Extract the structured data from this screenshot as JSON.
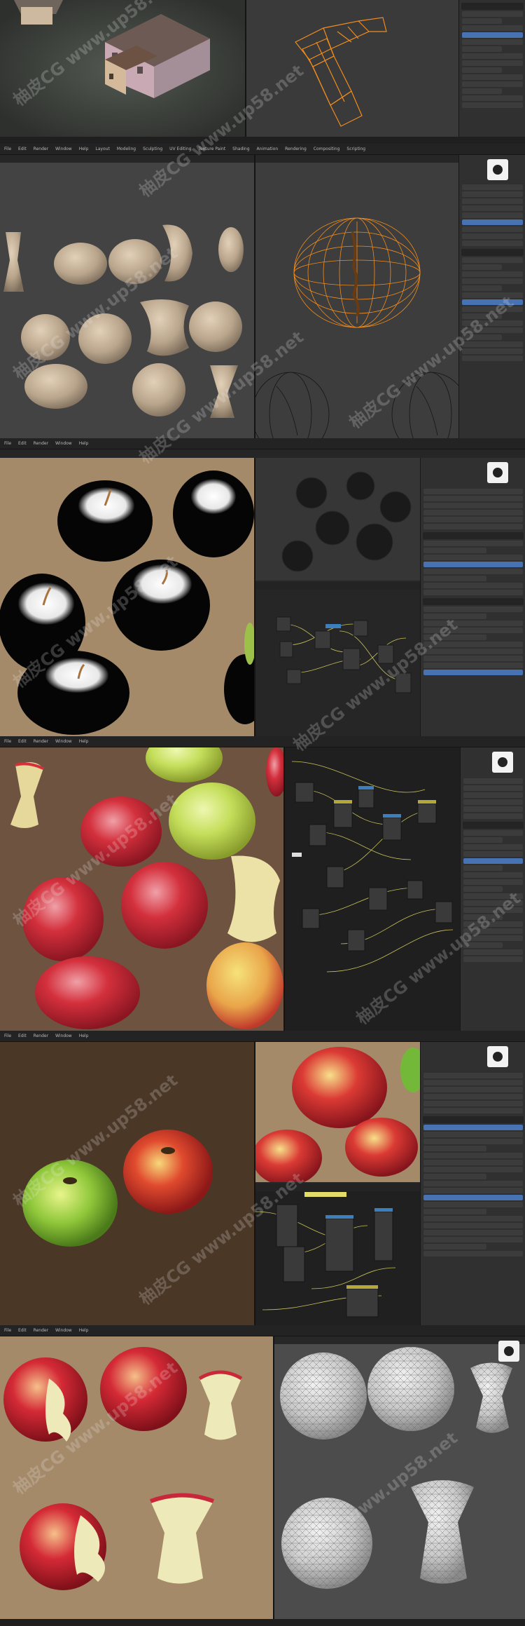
{
  "header": {
    "menus": [
      "File",
      "Edit",
      "Render",
      "Window",
      "Help",
      "Layout",
      "Modeling",
      "Sculpting",
      "UV Editing",
      "Texture Paint",
      "Shading",
      "Animation",
      "Rendering",
      "Compositing",
      "Scripting"
    ]
  },
  "panels": [
    {
      "id": "houses-wireframe"
    },
    {
      "id": "apple-sculpt"
    },
    {
      "id": "black-apples-nodes"
    },
    {
      "id": "red-apples-shading"
    },
    {
      "id": "two-apples-render"
    },
    {
      "id": "bitten-apples-wireframe"
    }
  ],
  "watermark": {
    "text": "柚皮CG www.up58.net"
  },
  "colors": {
    "ui_bg": "#262626",
    "sidebar": "#303030",
    "selection": "#4772b3",
    "wire_orange": "#f08c1e",
    "beige_bg": "#a58a6a",
    "brown_bg": "#4a3726",
    "dark_bg": "#1f1f1f"
  }
}
